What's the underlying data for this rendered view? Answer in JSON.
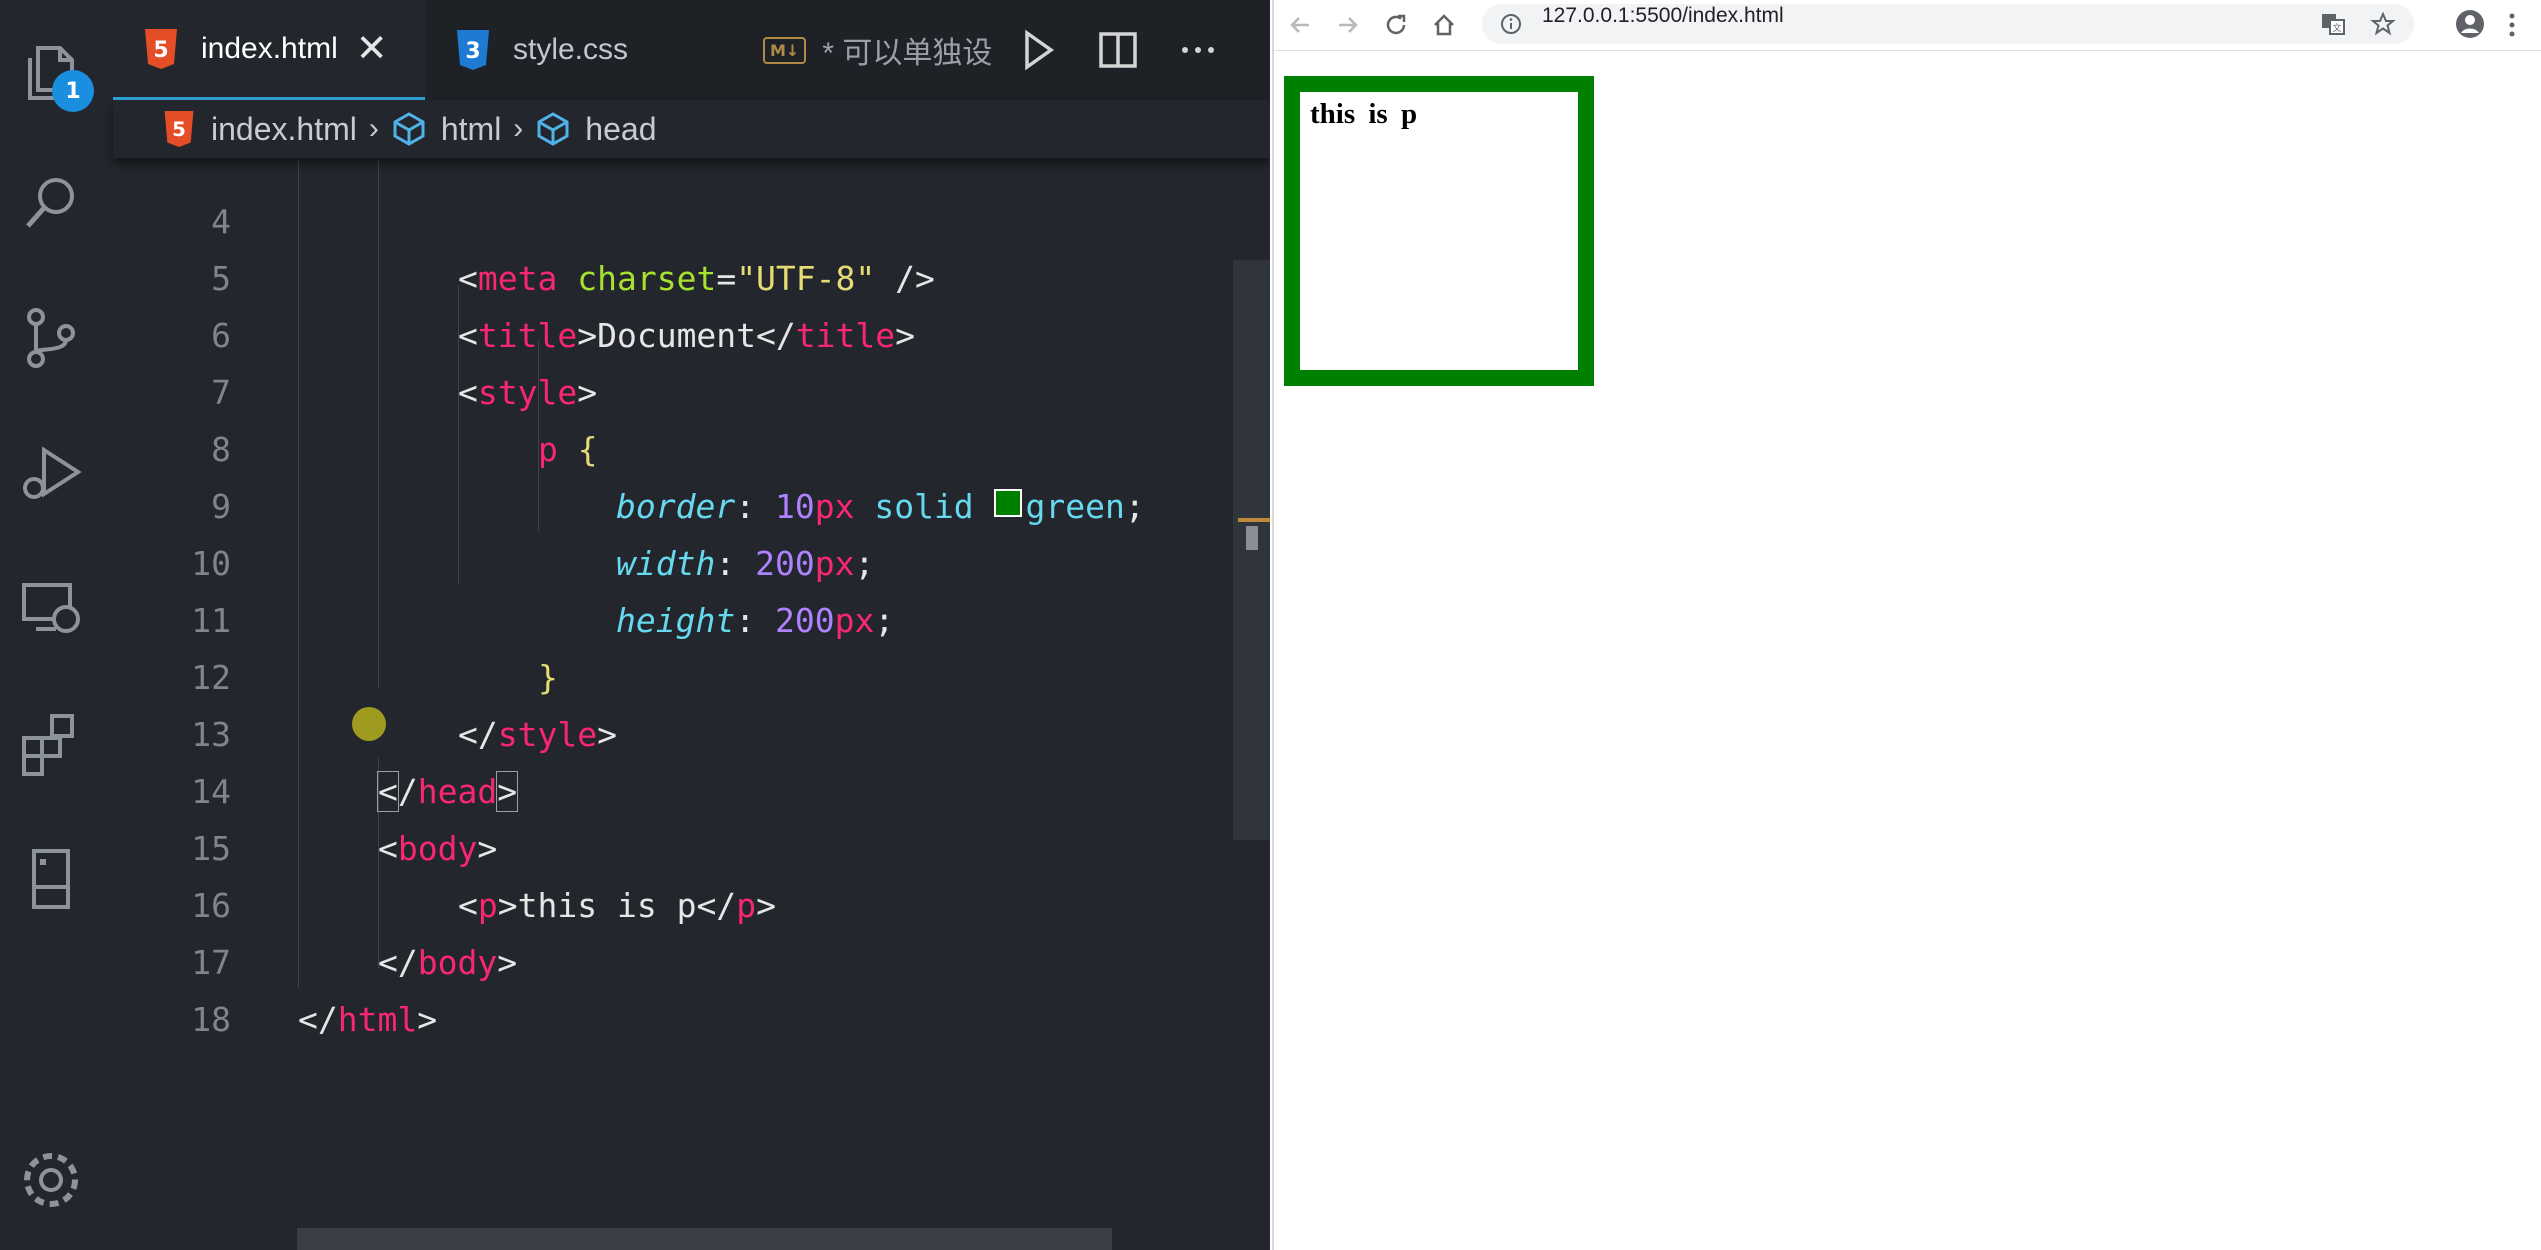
{
  "editor": {
    "tabs": [
      {
        "label": "index.html",
        "icon": "html5-icon",
        "active": true,
        "close": "✕"
      },
      {
        "label": "style.css",
        "icon": "css3-icon",
        "active": false
      },
      {
        "label": "* 可以单独设",
        "icon": "markdown-icon",
        "badge": "M↓",
        "active": false
      }
    ],
    "activity_badge": "1",
    "breadcrumb": [
      "index.html",
      "html",
      "head"
    ],
    "breadcrumb_sep": "›",
    "line_numbers": [
      "4",
      "5",
      "6",
      "7",
      "8",
      "9",
      "10",
      "11",
      "12",
      "13",
      "14",
      "15",
      "16",
      "17",
      "18"
    ],
    "code": {
      "l4": {
        "lt": "<",
        "tag": "meta",
        "attr": " charset",
        "eq": "=",
        "str": "\"UTF-8\"",
        "end": " />"
      },
      "l5": {
        "o": "<",
        "tag": "title",
        "c": ">",
        "text": "Document",
        "o2": "</",
        "tag2": "title",
        "c2": ">"
      },
      "l6": {
        "o": "<",
        "tag": "style",
        "c": ">"
      },
      "l7": {
        "sel": "p",
        "brace": " {"
      },
      "l8": {
        "prop": "border",
        "colon": ": ",
        "num": "10",
        "unit": "px",
        "kw": " solid ",
        "color": "green",
        "semi": ";"
      },
      "l9": {
        "prop": "width",
        "colon": ": ",
        "num": "200",
        "unit": "px",
        "semi": ";"
      },
      "l10": {
        "prop": "height",
        "colon": ": ",
        "num": "200",
        "unit": "px",
        "semi": ";"
      },
      "l11": {
        "brace": "}"
      },
      "l12": {
        "o": "</",
        "tag": "style",
        "c": ">"
      },
      "l13": {
        "o": "<",
        "slash": "/",
        "tag": "head",
        "c": ">"
      },
      "l14": {
        "o": "<",
        "tag": "body",
        "c": ">"
      },
      "l15": {
        "o": "<",
        "tag": "p",
        "c": ">",
        "text": "this is p",
        "o2": "</",
        "tag2": "p",
        "c2": ">"
      },
      "l16": {
        "o": "</",
        "tag": "body",
        "c": ">"
      },
      "l17": {
        "o": "</",
        "tag": "html",
        "c": ">"
      }
    },
    "colors": {
      "tag": "#f92672",
      "string": "#e6db74",
      "property": "#66d9ef",
      "number": "#ae81ff",
      "swatch": "#008000"
    }
  },
  "browser": {
    "url": "127.0.0.1:5500/index.html",
    "rendered_paragraph": "this is p",
    "box_color": "#008000"
  }
}
